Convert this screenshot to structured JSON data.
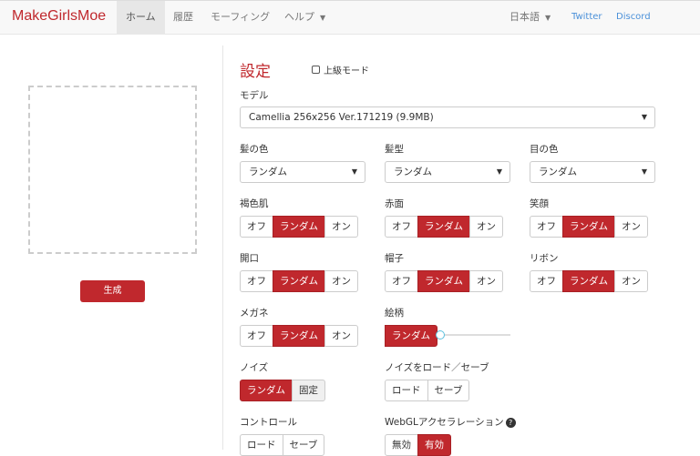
{
  "nav": {
    "brand": "MakeGirlsMoe",
    "items": [
      "ホーム",
      "履歴",
      "モーフィング",
      "ヘルプ"
    ],
    "language": "日本語",
    "twitter": "Twitter",
    "discord": "Discord"
  },
  "left": {
    "generate": "生成"
  },
  "settings": {
    "title": "設定",
    "advanced_mode": "上級モード",
    "model_label": "モデル",
    "model_value": "Camellia 256x256 Ver.171219 (9.9MB)",
    "hair_color_label": "髪の色",
    "hair_color": "ランダム",
    "hair_style_label": "髪型",
    "hair_style": "ランダム",
    "eye_color_label": "目の色",
    "eye_color": "ランダム",
    "off": "オフ",
    "random": "ランダム",
    "on": "オン",
    "dark_skin": "褐色肌",
    "blush": "赤面",
    "smile": "笑顔",
    "open_mouth": "開口",
    "hat": "帽子",
    "ribbon": "リボン",
    "glasses": "メガネ",
    "style_label": "絵柄",
    "style_button": "ランダム",
    "style_level": 0,
    "noise_label": "ノイズ",
    "noise_random": "ランダム",
    "noise_fixed": "固定",
    "noise_io_label": "ノイズをロード／セーブ",
    "load": "ロード",
    "save": "セーブ",
    "control_label": "コントロール",
    "webgl_label": "WebGLアクセラレーション",
    "webgl_off": "無効",
    "webgl_on": "有効",
    "help": "?"
  }
}
